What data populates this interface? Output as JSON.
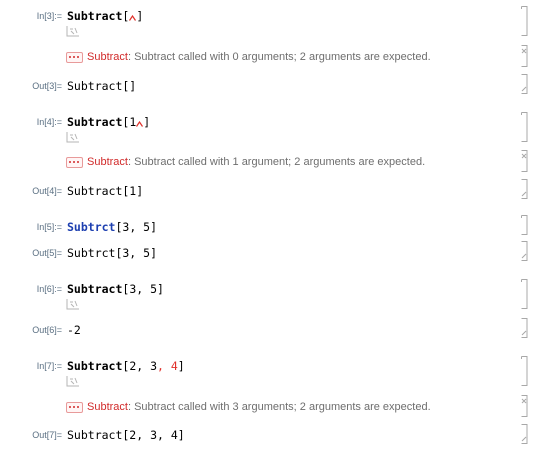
{
  "cells": {
    "c1": {
      "in_label": "In[3]:=",
      "input_cmd": "Subtract",
      "input_rest_open": "[",
      "input_rest_close": "]",
      "msg_symbol": "Subtract",
      "msg_text": ": Subtract called with 0 arguments; 2 arguments are expected.",
      "out_label": "Out[3]=",
      "output": "Subtract[]"
    },
    "c2": {
      "in_label": "In[4]:=",
      "input_cmd": "Subtract",
      "input_rest_open": "[1",
      "input_rest_close": "]",
      "msg_symbol": "Subtract",
      "msg_text": ": Subtract called with 1 argument; 2 arguments are expected.",
      "out_label": "Out[4]=",
      "output": "Subtract[1]"
    },
    "c3": {
      "in_label": "In[5]:=",
      "input_cmd": "Subtrct",
      "input_rest": "[3, 5]",
      "out_label": "Out[5]=",
      "output": "Subtrct[3, 5]"
    },
    "c4": {
      "in_label": "In[6]:=",
      "input_cmd": "Subtract",
      "input_rest": "[3, 5]",
      "out_label": "Out[6]=",
      "output": "-2"
    },
    "c5": {
      "in_label": "In[7]:=",
      "input_cmd": "Subtract",
      "input_rest_a": "[2, 3",
      "input_rest_red": ", 4",
      "input_rest_close": "]",
      "msg_symbol": "Subtract",
      "msg_text": ": Subtract called with 3 arguments; 2 arguments are expected.",
      "out_label": "Out[7]=",
      "output": "Subtract[2, 3, 4]"
    }
  },
  "colors": {
    "label": "#5a6f82",
    "message_symbol": "#d12a2a",
    "undefined_symbol": "#1d3fb0",
    "extra_argument": "#e0302a",
    "bracket": "#a8a8a8"
  },
  "icons": {
    "suggestions": "suggestion-bar-icon",
    "message_menu": "message-dots-icon",
    "cell_bracket": "cell-bracket-icon"
  }
}
